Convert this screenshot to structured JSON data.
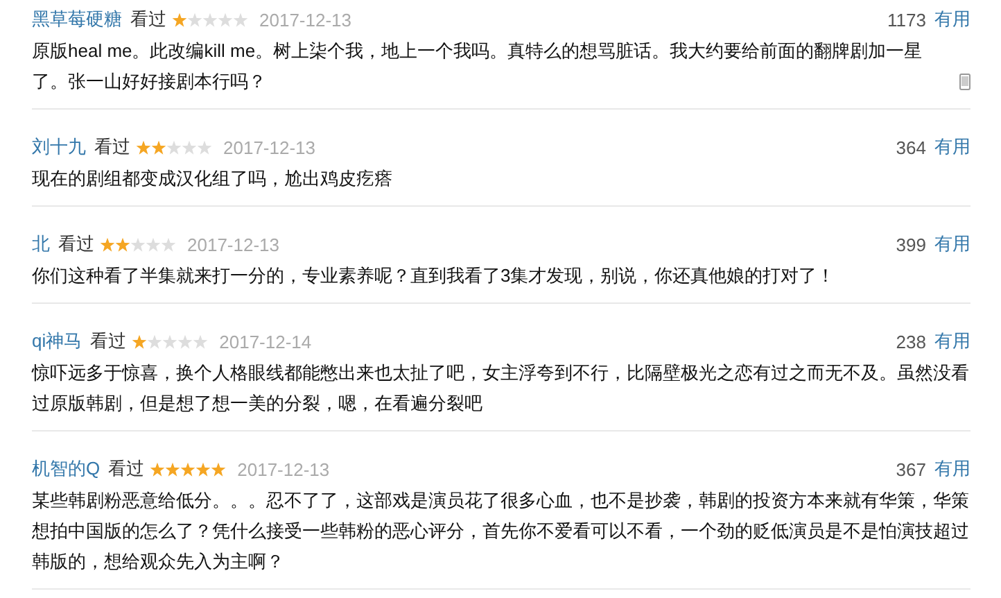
{
  "comments": [
    {
      "user": "黑草莓硬糖",
      "status": "看过",
      "stars": 1,
      "date": "2017-12-13",
      "votes": "1173",
      "useful": "有用",
      "text": "原版heal me。此改编kill me。树上柒个我，地上一个我吗。真特么的想骂脏话。我大约要给前面的翻牌剧加一星了。张一山好好接剧本行吗？",
      "mobile": true
    },
    {
      "user": "刘十九",
      "status": "看过",
      "stars": 2,
      "date": "2017-12-13",
      "votes": "364",
      "useful": "有用",
      "text": "现在的剧组都变成汉化组了吗，尬出鸡皮疙瘩",
      "mobile": false
    },
    {
      "user": "北",
      "status": "看过",
      "stars": 2,
      "date": "2017-12-13",
      "votes": "399",
      "useful": "有用",
      "text": "你们这种看了半集就来打一分的，专业素养呢？直到我看了3集才发现，别说，你还真他娘的打对了！",
      "mobile": false
    },
    {
      "user": "qi神马",
      "status": "看过",
      "stars": 1,
      "date": "2017-12-14",
      "votes": "238",
      "useful": "有用",
      "text": "惊吓远多于惊喜，换个人格眼线都能憋出来也太扯了吧，女主浮夸到不行，比隔壁极光之恋有过之而无不及。虽然没看过原版韩剧，但是想了想一美的分裂，嗯，在看遍分裂吧",
      "mobile": false
    },
    {
      "user": "机智的Q",
      "status": "看过",
      "stars": 5,
      "date": "2017-12-13",
      "votes": "367",
      "useful": "有用",
      "text": "某些韩剧粉恶意给低分。。。忍不了了，这部戏是演员花了很多心血，也不是抄袭，韩剧的投资方本来就有华策，华策想拍中国版的怎么了？凭什么接受一些韩粉的恶心评分，首先你不爱看可以不看，一个劲的贬低演员是不是怕演技超过韩版的，想给观众先入为主啊？",
      "mobile": false
    }
  ]
}
